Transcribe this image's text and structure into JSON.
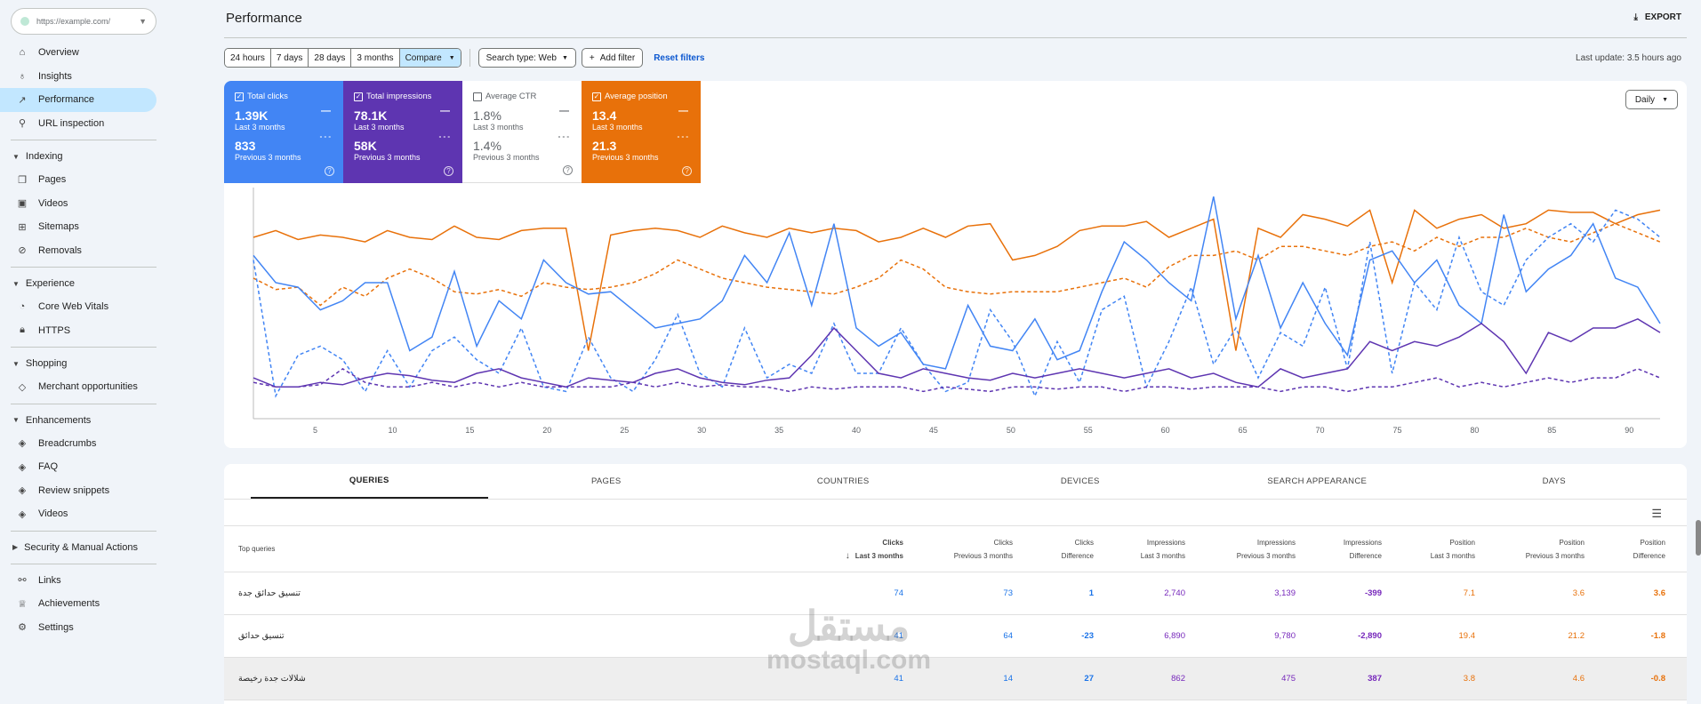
{
  "sidebar": {
    "property": "https://example.com/",
    "items": [
      {
        "label": "Overview",
        "icon": "home-icon",
        "glyph": "⌂"
      },
      {
        "label": "Insights",
        "icon": "lightbulb-icon",
        "glyph": "♁"
      },
      {
        "label": "Performance",
        "icon": "trending-up-icon",
        "glyph": "↗"
      },
      {
        "label": "URL inspection",
        "icon": "search-icon",
        "glyph": "⚲"
      }
    ],
    "sections": [
      {
        "label": "Indexing",
        "items": [
          {
            "label": "Pages",
            "icon": "pages-icon",
            "glyph": "❐"
          },
          {
            "label": "Videos",
            "icon": "video-icon",
            "glyph": "▣"
          },
          {
            "label": "Sitemaps",
            "icon": "sitemap-icon",
            "glyph": "⊞"
          },
          {
            "label": "Removals",
            "icon": "removals-icon",
            "glyph": "⊘"
          }
        ]
      },
      {
        "label": "Experience",
        "items": [
          {
            "label": "Core Web Vitals",
            "icon": "speed-icon",
            "glyph": "◔"
          },
          {
            "label": "HTTPS",
            "icon": "lock-icon",
            "glyph": "🔒︎"
          }
        ]
      },
      {
        "label": "Shopping",
        "items": [
          {
            "label": "Merchant opportunities",
            "icon": "tag-icon",
            "glyph": "◇"
          }
        ]
      },
      {
        "label": "Enhancements",
        "items": [
          {
            "label": "Breadcrumbs",
            "icon": "layers-icon",
            "glyph": "◈"
          },
          {
            "label": "FAQ",
            "icon": "layers-icon",
            "glyph": "◈"
          },
          {
            "label": "Review snippets",
            "icon": "layers-icon",
            "glyph": "◈"
          },
          {
            "label": "Videos",
            "icon": "layers-icon",
            "glyph": "◈"
          }
        ]
      },
      {
        "label": "Security & Manual Actions",
        "collapsed": true,
        "items": []
      }
    ],
    "footer": [
      {
        "label": "Links",
        "icon": "links-icon",
        "glyph": "⚯"
      },
      {
        "label": "Achievements",
        "icon": "trophy-icon",
        "glyph": "♕"
      },
      {
        "label": "Settings",
        "icon": "gear-icon",
        "glyph": "⚙"
      }
    ]
  },
  "header": {
    "title": "Performance",
    "export": "EXPORT"
  },
  "filters": {
    "ranges": [
      "24 hours",
      "7 days",
      "28 days",
      "3 months"
    ],
    "compare": "Compare",
    "search_type": "Search type: Web",
    "add_filter": "Add filter",
    "reset": "Reset filters",
    "last_update": "Last update: 3.5 hours ago"
  },
  "metrics": [
    {
      "label": "Total clicks",
      "checked": true,
      "value": "1.39K",
      "period": "Last 3 months",
      "prev_value": "833",
      "prev_period": "Previous 3 months",
      "color": "#4285f4"
    },
    {
      "label": "Total impressions",
      "checked": true,
      "value": "78.1K",
      "period": "Last 3 months",
      "prev_value": "58K",
      "prev_period": "Previous 3 months",
      "color": "#5e35b1"
    },
    {
      "label": "Average CTR",
      "checked": false,
      "value": "1.8%",
      "period": "Last 3 months",
      "prev_value": "1.4%",
      "prev_period": "Previous 3 months",
      "color": "#ffffff"
    },
    {
      "label": "Average position",
      "checked": true,
      "value": "13.4",
      "period": "Last 3 months",
      "prev_value": "21.3",
      "prev_period": "Previous 3 months",
      "color": "#e8710a"
    }
  ],
  "granularity": "Daily",
  "chart_data": {
    "type": "line",
    "x_ticks": [
      5,
      10,
      15,
      20,
      25,
      30,
      35,
      40,
      45,
      50,
      55,
      60,
      65,
      70,
      75,
      80,
      85,
      90
    ],
    "xlim": [
      1,
      92
    ],
    "ylim": [
      0,
      100
    ],
    "x_step": 2,
    "series": [
      {
        "name": "Average position (last 3 months)",
        "color": "#e8710a",
        "dashed": false,
        "values": [
          80,
          83,
          79,
          81,
          80,
          78,
          83,
          80,
          79,
          85,
          80,
          79,
          83,
          84,
          84,
          30,
          81,
          83,
          84,
          83,
          80,
          85,
          82,
          80,
          84,
          82,
          84,
          83,
          78,
          80,
          84,
          80,
          85,
          86,
          70,
          72,
          76,
          83,
          85,
          85,
          87,
          80,
          84,
          88,
          30,
          84,
          80,
          90,
          88,
          85,
          92,
          60,
          92,
          84,
          88,
          90,
          84,
          86,
          92,
          91,
          91,
          86,
          90,
          92
        ]
      },
      {
        "name": "Average position (previous 3 months)",
        "color": "#e8710a",
        "dashed": true,
        "values": [
          62,
          57,
          58,
          50,
          58,
          54,
          62,
          66,
          62,
          56,
          55,
          57,
          54,
          60,
          58,
          57,
          58,
          60,
          64,
          70,
          66,
          62,
          60,
          58,
          57,
          56,
          55,
          58,
          62,
          70,
          66,
          58,
          56,
          55,
          56,
          56,
          56,
          58,
          60,
          62,
          58,
          67,
          72,
          72,
          74,
          70,
          76,
          76,
          74,
          72,
          76,
          78,
          74,
          80,
          76,
          80,
          80,
          84,
          80,
          78,
          82,
          86,
          82,
          78
        ]
      },
      {
        "name": "Clicks (last 3 months)",
        "color": "#4285f4",
        "dashed": false,
        "values": [
          72,
          60,
          58,
          48,
          52,
          60,
          60,
          30,
          36,
          65,
          32,
          52,
          44,
          70,
          60,
          55,
          56,
          48,
          40,
          42,
          44,
          52,
          72,
          60,
          82,
          50,
          86,
          40,
          32,
          38,
          24,
          22,
          50,
          32,
          30,
          44,
          26,
          30,
          56,
          78,
          70,
          60,
          52,
          98,
          44,
          72,
          40,
          60,
          42,
          28,
          70,
          74,
          60,
          70,
          50,
          42,
          90,
          56,
          66,
          72,
          86,
          62,
          58,
          42
        ]
      },
      {
        "name": "Clicks (previous 3 months)",
        "color": "#4285f4",
        "dashed": true,
        "values": [
          70,
          10,
          28,
          32,
          26,
          12,
          30,
          14,
          30,
          36,
          26,
          20,
          40,
          14,
          12,
          36,
          18,
          12,
          26,
          46,
          20,
          14,
          40,
          18,
          24,
          20,
          42,
          20,
          20,
          40,
          24,
          12,
          16,
          48,
          34,
          10,
          34,
          16,
          48,
          54,
          14,
          34,
          58,
          24,
          40,
          18,
          38,
          32,
          58,
          22,
          78,
          20,
          60,
          48,
          80,
          56,
          50,
          70,
          80,
          86,
          78,
          92,
          88,
          80
        ]
      },
      {
        "name": "Impressions (last 3 months)",
        "color": "#5e35b1",
        "dashed": false,
        "values": [
          18,
          14,
          14,
          16,
          15,
          18,
          20,
          19,
          17,
          16,
          20,
          22,
          18,
          16,
          14,
          18,
          17,
          16,
          20,
          22,
          18,
          16,
          15,
          17,
          18,
          28,
          40,
          30,
          20,
          18,
          22,
          20,
          18,
          17,
          20,
          18,
          20,
          22,
          20,
          18,
          20,
          22,
          18,
          20,
          16,
          14,
          22,
          18,
          20,
          22,
          34,
          30,
          34,
          32,
          36,
          42,
          34,
          20,
          38,
          34,
          40,
          40,
          44,
          38
        ]
      },
      {
        "name": "Impressions (previous 3 months)",
        "color": "#5e35b1",
        "dashed": true,
        "values": [
          16,
          14,
          14,
          15,
          22,
          16,
          14,
          14,
          16,
          14,
          16,
          14,
          16,
          14,
          14,
          14,
          14,
          16,
          14,
          16,
          14,
          15,
          14,
          14,
          12,
          14,
          13,
          14,
          14,
          14,
          12,
          14,
          13,
          12,
          14,
          14,
          13,
          14,
          14,
          12,
          14,
          14,
          13,
          14,
          14,
          14,
          12,
          14,
          14,
          12,
          14,
          14,
          16,
          18,
          14,
          16,
          14,
          16,
          18,
          16,
          18,
          18,
          22,
          18
        ]
      }
    ]
  },
  "table": {
    "tabs": [
      "QUERIES",
      "PAGES",
      "COUNTRIES",
      "DEVICES",
      "SEARCH APPEARANCE",
      "DAYS"
    ],
    "columns": [
      [
        "Top queries",
        ""
      ],
      [
        "Clicks",
        "Last 3 months"
      ],
      [
        "Clicks",
        "Previous 3 months"
      ],
      [
        "Clicks",
        "Difference"
      ],
      [
        "Impressions",
        "Last 3 months"
      ],
      [
        "Impressions",
        "Previous 3 months"
      ],
      [
        "Impressions",
        "Difference"
      ],
      [
        "Position",
        "Last 3 months"
      ],
      [
        "Position",
        "Previous 3 months"
      ],
      [
        "Position",
        "Difference"
      ]
    ],
    "rows": [
      [
        "تنسيق حدائق جدة",
        "74",
        "73",
        "1",
        "2,740",
        "3,139",
        "-399",
        "7.1",
        "3.6",
        "3.6"
      ],
      [
        "تنسيق حدائق",
        "41",
        "64",
        "-23",
        "6,890",
        "9,780",
        "-2,890",
        "19.4",
        "21.2",
        "-1.8"
      ],
      [
        "شلالات جدة رخيصة",
        "41",
        "14",
        "27",
        "862",
        "475",
        "387",
        "3.8",
        "4.6",
        "-0.8"
      ]
    ]
  },
  "watermark": {
    "ar": "مستقل",
    "en": "mostaql.com"
  }
}
